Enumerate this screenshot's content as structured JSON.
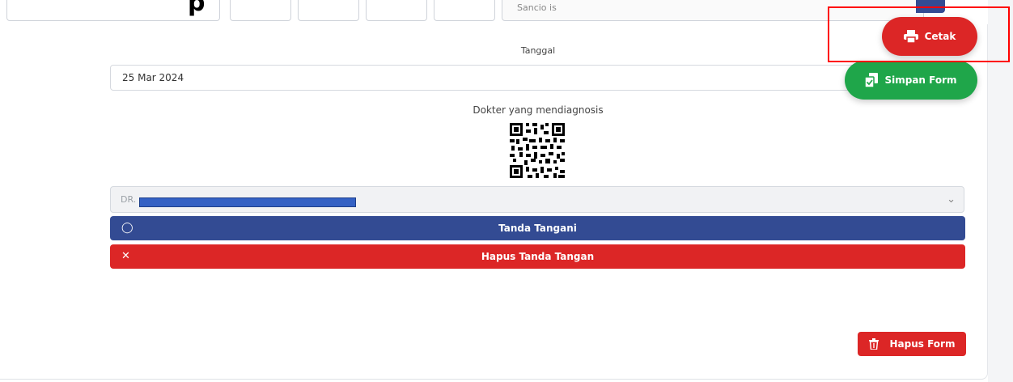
{
  "top": {
    "caption_fragment": "p                                                    p",
    "select_value": "Sancio is"
  },
  "form": {
    "date_label": "Tanggal",
    "date_value": "25 Mar 2024",
    "doctor_label": "Dokter yang mendiagnosis",
    "doctor_select_prefix": "DR.",
    "sign_button": "Tanda Tangani",
    "delete_sign_button": "Hapus Tanda Tangan",
    "delete_form_button": "Hapus Form"
  },
  "actions": {
    "print_button": "Cetak",
    "save_button": "Simpan Form"
  },
  "colors": {
    "primary": "#334b93",
    "danger": "#dc2626",
    "success": "#1fa64a",
    "highlight": "#ff0000"
  }
}
